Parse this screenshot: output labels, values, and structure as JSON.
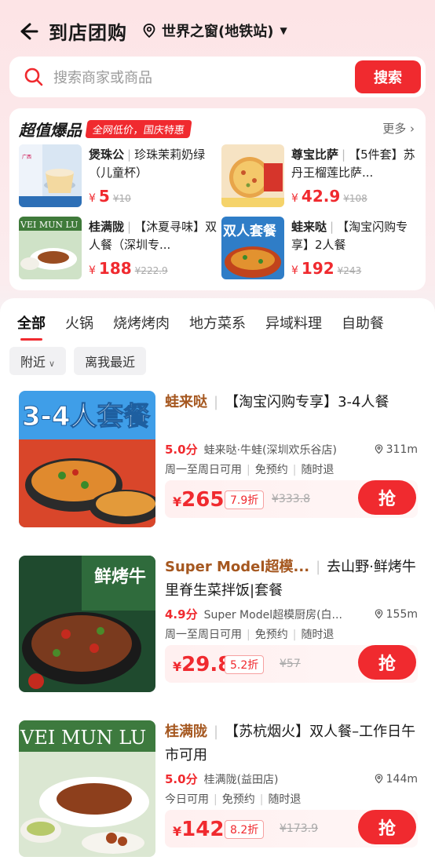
{
  "header": {
    "title": "到店团购",
    "location": "世界之窗(地铁站)"
  },
  "search": {
    "placeholder": "搜索商家或商品",
    "button": "搜索"
  },
  "deals": {
    "title": "超值爆品",
    "tag": "全网低价，国庆特惠",
    "more": "更多",
    "items": [
      {
        "brand": "煲珠公",
        "desc": "珍珠茉莉奶绿（儿童杯）",
        "price": "5",
        "old": "¥10"
      },
      {
        "brand": "尊宝比萨",
        "desc": "【5件套】苏丹王榴莲比萨...",
        "price": "42.9",
        "old": "¥108"
      },
      {
        "brand": "桂满陇",
        "desc": "【沐夏寻味】双人餐（深圳专...",
        "price": "188",
        "old": "¥222.9"
      },
      {
        "brand": "蛙来哒",
        "desc": "【淘宝闪购专享】2人餐",
        "price": "192",
        "old": "¥243"
      }
    ]
  },
  "tabs": [
    "全部",
    "火锅",
    "烧烤烤肉",
    "地方菜系",
    "异域料理",
    "自助餐"
  ],
  "filters": {
    "nearby": "附近",
    "closest": "离我最近"
  },
  "products": [
    {
      "brand": "蛙来哒",
      "title": "【淘宝闪购专享】3-4人餐",
      "score": "5.0分",
      "shop": "蛙来哒·牛蛙(深圳欢乐谷店)",
      "distance": "311m",
      "tags": [
        "周一至周日可用",
        "免预约",
        "随时退"
      ],
      "price": "265",
      "discount": "7.9折",
      "old": "¥333.8",
      "button": "抢"
    },
    {
      "brand": "Super Model超模...",
      "title": "去山野·鲜烤牛里脊生菜拌饭|套餐",
      "score": "4.9分",
      "shop": "Super Model超模厨房(白...",
      "distance": "155m",
      "tags": [
        "周一至周日可用",
        "免预约",
        "随时退"
      ],
      "price": "29.8",
      "discount": "5.2折",
      "old": "¥57",
      "button": "抢"
    },
    {
      "brand": "桂满陇",
      "title": "【苏杭烟火】双人餐–工作日午市可用",
      "score": "5.0分",
      "shop": "桂满陇(益田店)",
      "distance": "144m",
      "tags": [
        "今日可用",
        "免预约",
        "随时退"
      ],
      "price": "142",
      "discount": "8.2折",
      "old": "¥173.9",
      "button": "抢"
    }
  ],
  "image_text": {
    "deal_1": "3-4人套餐",
    "deal_2_tag": "双人套餐",
    "deal_3_banner": "VEI MUN LU",
    "product_1": "3-4人套餐",
    "product_2": "鲜烤牛",
    "product_3": "VEI MUN LU"
  }
}
